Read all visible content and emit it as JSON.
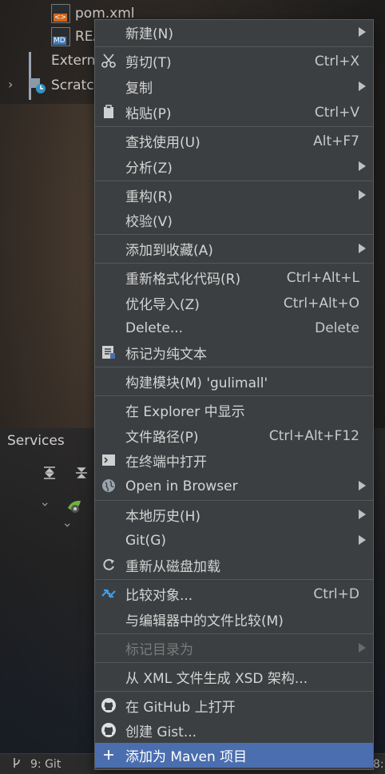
{
  "tree": {
    "pom_label": "pom.xml",
    "readme_label": "REA",
    "external_label": "Extern",
    "scratch_label": "Scratc"
  },
  "services": {
    "title": "Services"
  },
  "statusbar": {
    "git_label": "9: Git",
    "right_fragment": "8:"
  },
  "menu": {
    "items": [
      {
        "label": "新建(N)",
        "shortcut": "",
        "submenu": true
      },
      {
        "label": "剪切(T)",
        "shortcut": "Ctrl+X",
        "icon": "scissors-icon"
      },
      {
        "label": "复制",
        "shortcut": "",
        "submenu": true
      },
      {
        "label": "粘贴(P)",
        "shortcut": "Ctrl+V",
        "icon": "clipboard-icon"
      },
      {
        "label": "查找使用(U)",
        "shortcut": "Alt+F7"
      },
      {
        "label": "分析(Z)",
        "shortcut": "",
        "submenu": true
      },
      {
        "label": "重构(R)",
        "shortcut": "",
        "submenu": true
      },
      {
        "label": "校验(V)",
        "shortcut": ""
      },
      {
        "label": "添加到收藏(A)",
        "shortcut": "",
        "submenu": true
      },
      {
        "label": "重新格式化代码(R)",
        "shortcut": "Ctrl+Alt+L"
      },
      {
        "label": "优化导入(Z)",
        "shortcut": "Ctrl+Alt+O"
      },
      {
        "label": "Delete...",
        "shortcut": "Delete"
      },
      {
        "label": "标记为纯文本",
        "shortcut": "",
        "icon": "plain-text-icon"
      },
      {
        "label": "构建模块(M) 'gulimall'",
        "shortcut": ""
      },
      {
        "label": "在 Explorer 中显示",
        "shortcut": ""
      },
      {
        "label": "文件路径(P)",
        "shortcut": "Ctrl+Alt+F12"
      },
      {
        "label": "在终端中打开",
        "shortcut": "",
        "icon": "terminal-icon"
      },
      {
        "label": "Open in Browser",
        "shortcut": "",
        "submenu": true,
        "icon": "globe-icon"
      },
      {
        "label": "本地历史(H)",
        "shortcut": "",
        "submenu": true
      },
      {
        "label": "Git(G)",
        "shortcut": "",
        "submenu": true
      },
      {
        "label": "重新从磁盘加载",
        "shortcut": "",
        "icon": "reload-icon"
      },
      {
        "label": "比较对象...",
        "shortcut": "Ctrl+D",
        "icon": "compare-icon"
      },
      {
        "label": "与编辑器中的文件比较(M)",
        "shortcut": ""
      },
      {
        "label": "标记目录为",
        "shortcut": "",
        "submenu": true,
        "disabled": true
      },
      {
        "label": "从 XML 文件生成 XSD 架构...",
        "shortcut": ""
      },
      {
        "label": "在 GitHub 上打开",
        "shortcut": "",
        "icon": "github-icon"
      },
      {
        "label": "创建 Gist...",
        "shortcut": "",
        "icon": "github-icon"
      },
      {
        "label": "添加为 Maven 项目",
        "shortcut": "",
        "icon": "plus-icon",
        "selected": true
      }
    ]
  },
  "colors": {
    "menu_bg": "#3c3f41",
    "selected_bg": "#4b6eaf",
    "separator": "#555859",
    "text": "#d4d4d4",
    "disabled_text": "#7a7a7a"
  }
}
